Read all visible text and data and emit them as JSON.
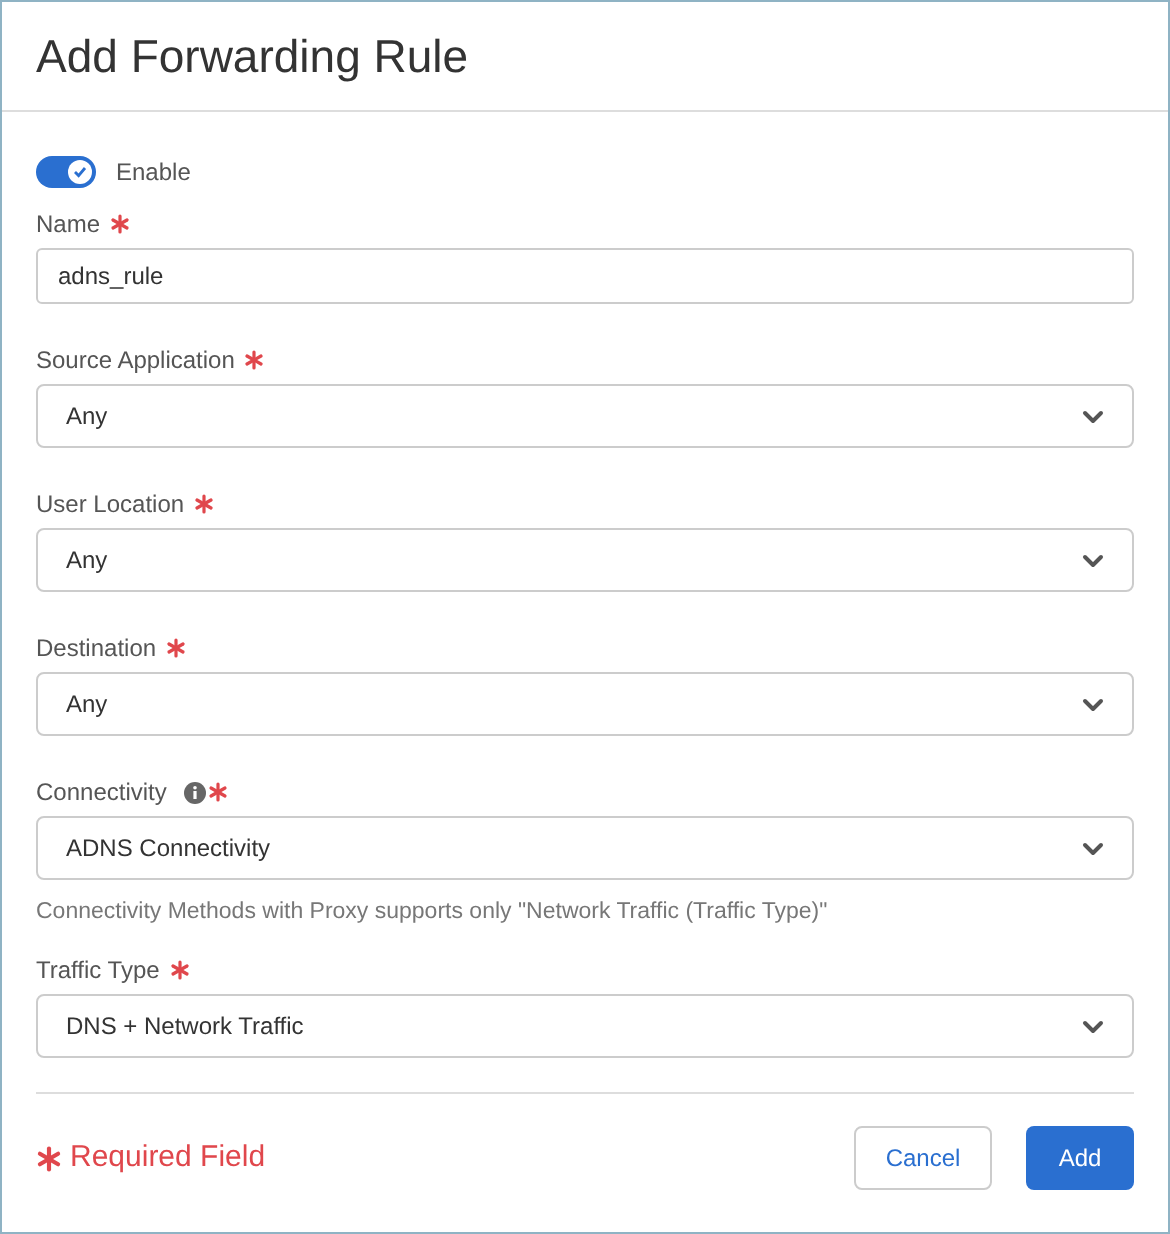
{
  "dialog": {
    "title": "Add Forwarding Rule"
  },
  "enable": {
    "label": "Enable",
    "on": true
  },
  "fields": [
    {
      "kind": "text",
      "label": "Name",
      "required": true,
      "value": "adns_rule"
    },
    {
      "kind": "select",
      "label": "Source Application",
      "required": true,
      "value": "Any"
    },
    {
      "kind": "select",
      "label": "User Location",
      "required": true,
      "value": "Any"
    },
    {
      "kind": "select",
      "label": "Destination",
      "required": true,
      "value": "Any"
    },
    {
      "kind": "select",
      "label": "Connectivity",
      "required": true,
      "info": true,
      "value": "ADNS Connectivity",
      "hint": "Connectivity Methods with Proxy supports only \"Network Traffic (Traffic Type)\""
    },
    {
      "kind": "select",
      "label": "Traffic Type",
      "required": true,
      "value": "DNS + Network Traffic"
    }
  ],
  "footer": {
    "required_note": "Required Field",
    "buttons": [
      {
        "label": "Cancel",
        "kind": "secondary"
      },
      {
        "label": "Add",
        "kind": "primary"
      }
    ]
  }
}
